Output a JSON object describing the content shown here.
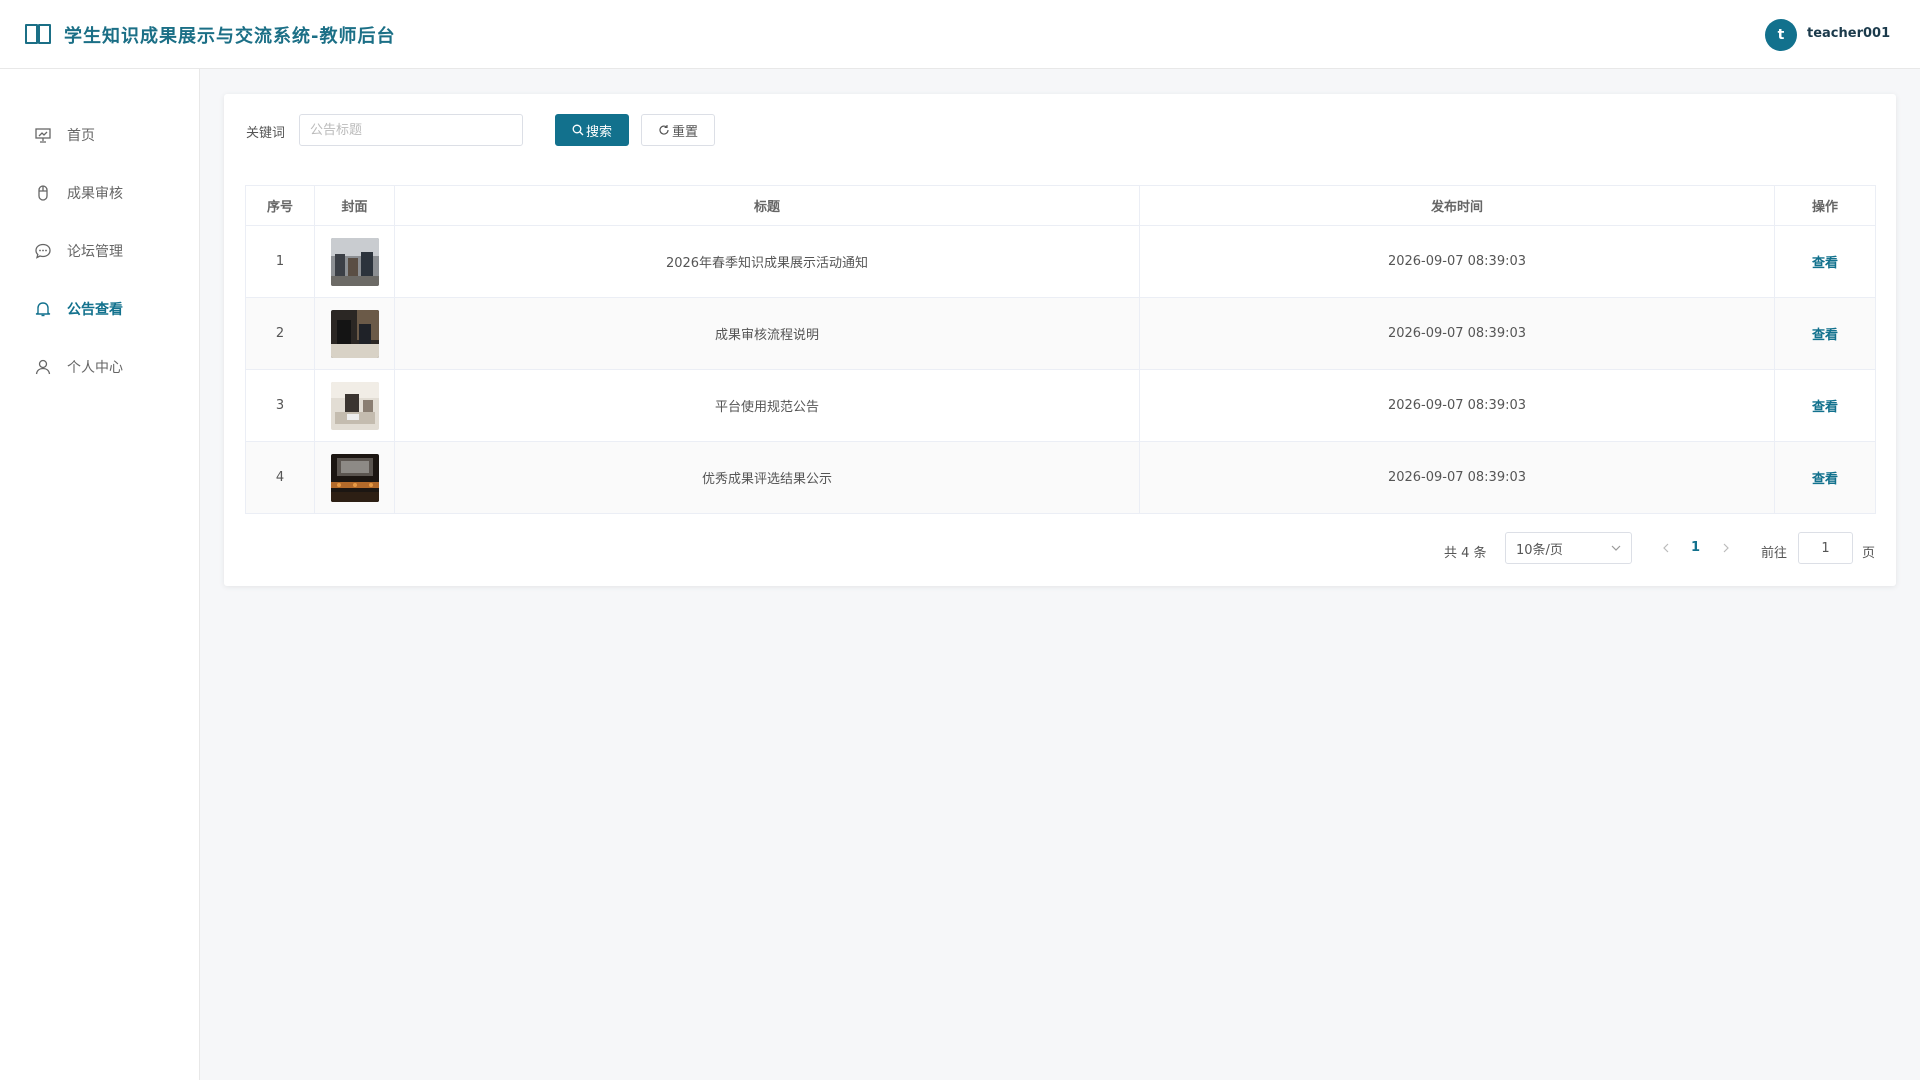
{
  "header": {
    "title": "学生知识成果展示与交流系统-教师后台",
    "avatar_letter": "t",
    "username": "teacher001"
  },
  "sidebar": {
    "items": [
      {
        "label": "首页",
        "icon": "presentation-board-icon",
        "active": false
      },
      {
        "label": "成果审核",
        "icon": "mouse-icon",
        "active": false
      },
      {
        "label": "论坛管理",
        "icon": "chat-bubble-icon",
        "active": false
      },
      {
        "label": "公告查看",
        "icon": "bell-icon",
        "active": true
      },
      {
        "label": "个人中心",
        "icon": "user-icon",
        "active": false
      }
    ]
  },
  "search": {
    "label": "关键词",
    "placeholder": "公告标题",
    "value": "",
    "search_label": "搜索",
    "reset_label": "重置"
  },
  "table": {
    "columns": [
      "序号",
      "封面",
      "标题",
      "发布时间",
      "操作"
    ],
    "rows": [
      {
        "index": "1",
        "title": "2026年春季知识成果展示活动通知",
        "time": "2026-09-07 08:39:03",
        "action": "查看"
      },
      {
        "index": "2",
        "title": "成果审核流程说明",
        "time": "2026-09-07 08:39:03",
        "action": "查看"
      },
      {
        "index": "3",
        "title": "平台使用规范公告",
        "time": "2026-09-07 08:39:03",
        "action": "查看"
      },
      {
        "index": "4",
        "title": "优秀成果评选结果公示",
        "time": "2026-09-07 08:39:03",
        "action": "查看"
      }
    ]
  },
  "pagination": {
    "total_text": "共 4 条",
    "page_size": "10条/页",
    "current_page": "1",
    "goto_label": "前往",
    "goto_value": "1",
    "page_suffix": "页"
  },
  "colors": {
    "primary": "#12718d",
    "title": "#1b6f86"
  }
}
